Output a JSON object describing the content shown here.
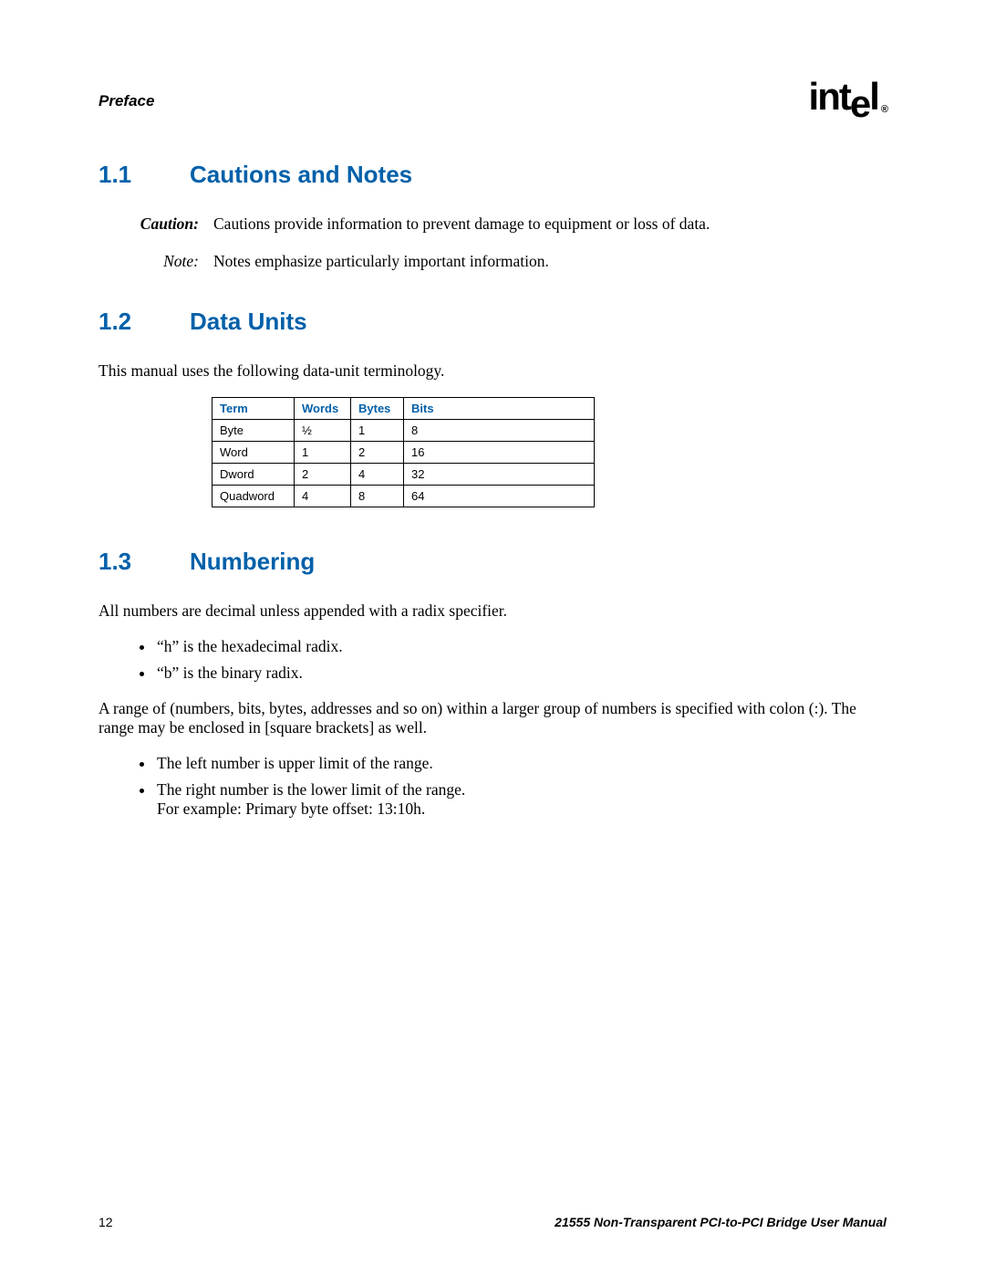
{
  "header": {
    "section": "Preface",
    "logo_text": "intel",
    "logo_reg": "®"
  },
  "sections": {
    "s1": {
      "num": "1.1",
      "title": "Cautions and Notes"
    },
    "s2": {
      "num": "1.2",
      "title": "Data Units"
    },
    "s3": {
      "num": "1.3",
      "title": "Numbering"
    }
  },
  "defs": {
    "caution_label": "Caution:",
    "caution_text": "Cautions provide information to prevent damage to equipment or loss of data.",
    "note_label": "Note:",
    "note_text": "Notes emphasize particularly important information."
  },
  "s2_intro": "This manual uses the following data-unit terminology.",
  "table": {
    "headers": {
      "term": "Term",
      "words": "Words",
      "bytes": "Bytes",
      "bits": "Bits"
    },
    "rows": [
      {
        "term": "Byte",
        "words": "½",
        "bytes": "1",
        "bits": "8"
      },
      {
        "term": "Word",
        "words": "1",
        "bytes": "2",
        "bits": "16"
      },
      {
        "term": "Dword",
        "words": "2",
        "bytes": "4",
        "bits": "32"
      },
      {
        "term": "Quadword",
        "words": "4",
        "bytes": "8",
        "bits": "64"
      }
    ]
  },
  "s3": {
    "p1": "All numbers are decimal unless appended with a radix specifier.",
    "b1a": "“h” is the hexadecimal radix.",
    "b1b": "“b” is the binary radix.",
    "p2": "A range of (numbers, bits, bytes, addresses and so on) within a larger group of numbers is specified with colon (:). The range may be enclosed in [square brackets] as well.",
    "b2a": "The left number is upper limit of the range.",
    "b2b": "The right number is the lower limit of the range.",
    "b2b_extra": "For example: Primary byte offset: 13:10h."
  },
  "footer": {
    "page": "12",
    "title": "21555 Non-Transparent PCI-to-PCI Bridge User Manual"
  }
}
